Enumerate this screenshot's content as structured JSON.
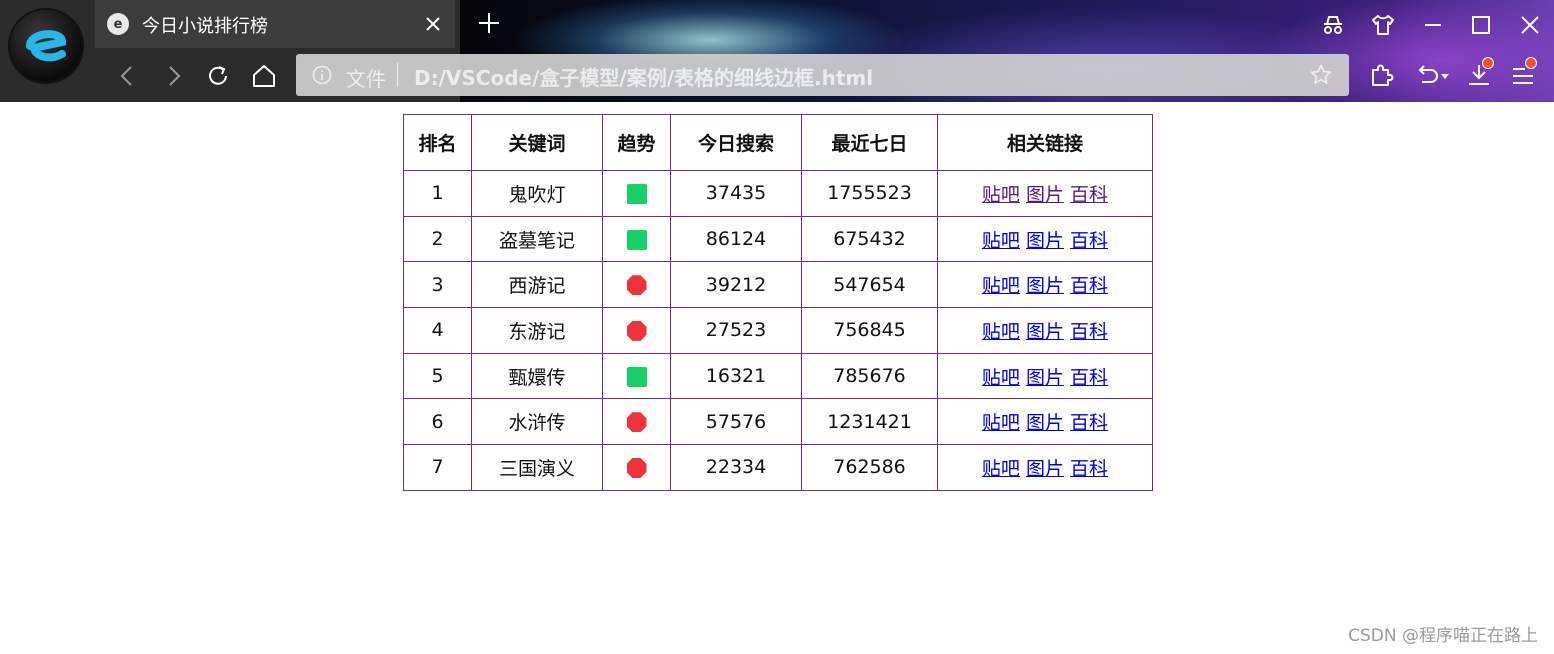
{
  "window": {
    "tab_title": "今日小说排行榜",
    "tab_favicon": "e",
    "address_scheme": "文件",
    "address_url": "D:/VSCode/盒子模型/案例/表格的细线边框.html"
  },
  "table": {
    "headers": {
      "rank": "排名",
      "keyword": "关键词",
      "trend": "趋势",
      "today": "今日搜索",
      "week": "最近七日",
      "links": "相关链接"
    },
    "link_labels": [
      "贴吧",
      "图片",
      "百科"
    ],
    "rows": [
      {
        "rank": "1",
        "keyword": "鬼吹灯",
        "trend": "up",
        "today": "37435",
        "week": "1755523",
        "visited": true
      },
      {
        "rank": "2",
        "keyword": "盗墓笔记",
        "trend": "up",
        "today": "86124",
        "week": "675432",
        "visited": false
      },
      {
        "rank": "3",
        "keyword": "西游记",
        "trend": "down",
        "today": "39212",
        "week": "547654",
        "visited": false
      },
      {
        "rank": "4",
        "keyword": "东游记",
        "trend": "down",
        "today": "27523",
        "week": "756845",
        "visited": false
      },
      {
        "rank": "5",
        "keyword": "甄嬛传",
        "trend": "up",
        "today": "16321",
        "week": "785676",
        "visited": false
      },
      {
        "rank": "6",
        "keyword": "水浒传",
        "trend": "down",
        "today": "57576",
        "week": "1231421",
        "visited": false
      },
      {
        "rank": "7",
        "keyword": "三国演义",
        "trend": "down",
        "today": "22334",
        "week": "762586",
        "visited": false
      }
    ]
  },
  "colors": {
    "border": "#6a2b9c",
    "trend_up": "#16d068",
    "trend_down": "#f0333a",
    "link": "#0000ee",
    "link_visited": "#551a8b"
  },
  "watermark": "CSDN @程序喵正在路上"
}
